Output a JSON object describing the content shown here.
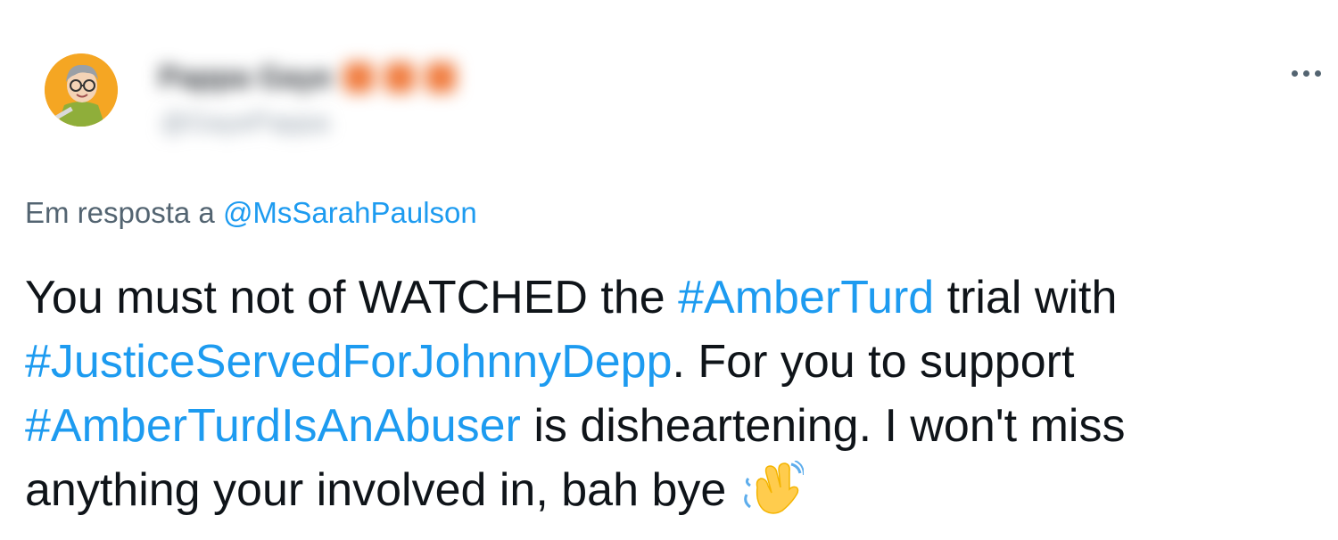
{
  "author": {
    "display_name": "Pappa Gaye",
    "handle": "@GayePappa"
  },
  "reply": {
    "prefix": "Em resposta a",
    "handle": "@MsSarahPaulson"
  },
  "tweet": {
    "line1": {
      "pre": "You must not of WATCHED the ",
      "tag": "#AmberTurd",
      "post": " trial with"
    },
    "line2": {
      "tag": "#JusticeServedForJohnnyDepp",
      "post": ". For you to support"
    },
    "line3": {
      "tag": "#AmberTurdIsAnAbuser",
      "post": " is disheartening. I won't miss"
    },
    "line4": {
      "text": "anything your involved in, bah bye "
    }
  },
  "icons": {
    "more": "more-horizontal-icon",
    "emoji": "waving-hand-emoji"
  },
  "colors": {
    "link": "#1d9bf0",
    "text": "#0f1419",
    "secondary": "#536471",
    "avatar_bg": "#f5a623"
  }
}
